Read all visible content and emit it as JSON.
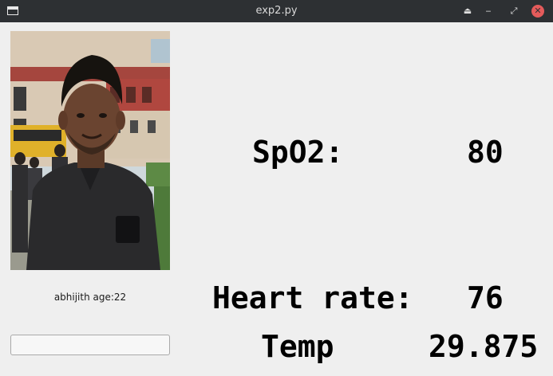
{
  "window": {
    "title": "exp2.py",
    "keep_above_glyph": "⏏",
    "minimize_glyph": "‒",
    "maximize_glyph": "⤢",
    "close_glyph": "✕",
    "close_color": "#e45b5b"
  },
  "profile": {
    "name_age": "abhijith age:22",
    "input_value": ""
  },
  "readings": {
    "spo2_label": "SpO2:",
    "spo2_value": "80",
    "heart_rate_label": "Heart rate:",
    "heart_rate_value": "76",
    "temp_label": "Temp",
    "temp_value": "29.875"
  }
}
